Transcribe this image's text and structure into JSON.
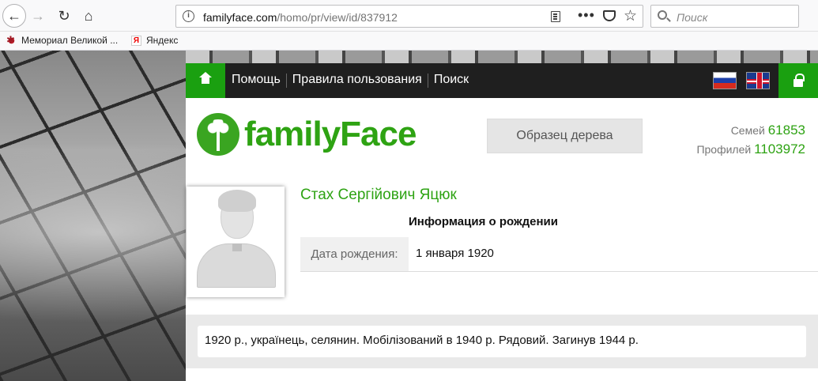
{
  "browser": {
    "url_domain": "familyface.com",
    "url_path": "/homo/pr/view/id/837912",
    "search_placeholder": "Поиск",
    "bookmarks": [
      {
        "label": "Мемориал Великой ...",
        "icon": "memorial-icon"
      },
      {
        "label": "Яндекс",
        "icon": "yandex-icon",
        "icon_glyph": "Я"
      }
    ]
  },
  "nav": {
    "links": [
      "Помощь",
      "Правила пользования",
      "Поиск"
    ],
    "languages": [
      "ru-flag-icon",
      "uk-flag-icon"
    ]
  },
  "header": {
    "logo_text": "familyFace",
    "sample_tree_button": "Образец дерева",
    "families_label": "Семей",
    "families_count": "61853",
    "profiles_label": "Профилей",
    "profiles_count": "1103972"
  },
  "profile": {
    "name": "Стах Сергійович Яцюк",
    "section_title": "Информация о рождении",
    "birth_date_label": "Дата рождения:",
    "birth_date_value": "1 января 1920",
    "bio": "1920 р., українець, селянин. Мобілізований в 1940 р. Рядовий. Загинув 1944 р."
  },
  "colors": {
    "brand_green": "#2ea313",
    "nav_green": "#1aa010",
    "nav_dark": "#1f1f1f"
  }
}
